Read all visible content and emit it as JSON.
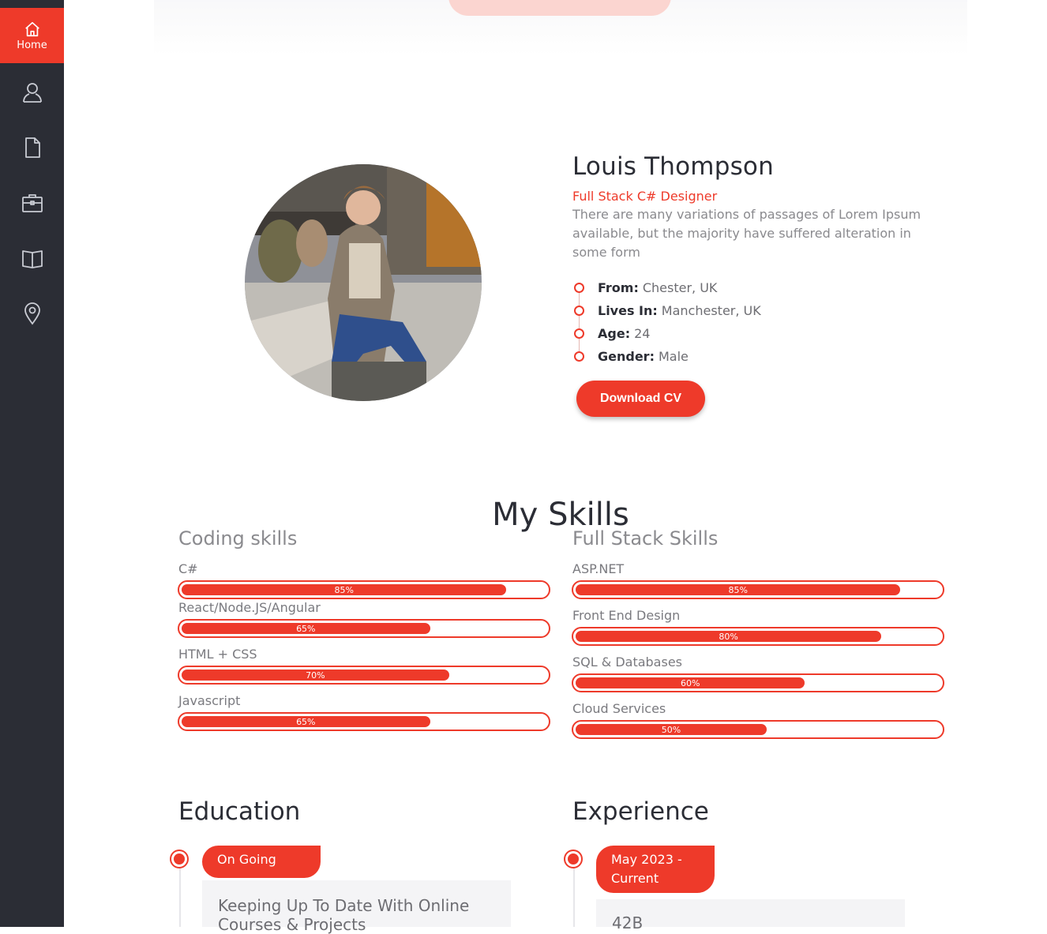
{
  "sidebar": {
    "items": [
      {
        "label": "Home",
        "icon": "home-icon"
      },
      {
        "label": "",
        "icon": "user-icon"
      },
      {
        "label": "",
        "icon": "document-icon"
      },
      {
        "label": "",
        "icon": "briefcase-icon"
      },
      {
        "label": "",
        "icon": "book-icon"
      },
      {
        "label": "",
        "icon": "map-pin-icon"
      }
    ]
  },
  "colors": {
    "accent": "#ee3a2a",
    "sidebar": "#2b2d35",
    "text": "#2b2d35",
    "muted": "#8a8a8e"
  },
  "profile": {
    "name": "Louis Thompson",
    "role": "Full Stack C# Designer",
    "description": "There are many variations of passages of Lorem Ipsum available, but the majority have suffered alteration in some form",
    "facts": [
      {
        "key": "From:",
        "value": "Chester, UK"
      },
      {
        "key": "Lives In:",
        "value": "Manchester, UK"
      },
      {
        "key": "Age:",
        "value": "24"
      },
      {
        "key": "Gender:",
        "value": "Male"
      }
    ],
    "cv_button": "Download CV"
  },
  "skills": {
    "title": "My Skills",
    "coding": {
      "title": "Coding skills",
      "items": [
        {
          "name": "C#",
          "percent": 85,
          "label": "85%"
        },
        {
          "name": "React/Node.JS/Angular",
          "percent": 65,
          "label": "65%"
        },
        {
          "name": "HTML + CSS",
          "percent": 70,
          "label": "70%"
        },
        {
          "name": "Javascript",
          "percent": 65,
          "label": "65%"
        }
      ]
    },
    "fullstack": {
      "title": "Full Stack Skills",
      "items": [
        {
          "name": "ASP.NET",
          "percent": 85,
          "label": "85%"
        },
        {
          "name": "Front End Design",
          "percent": 80,
          "label": "80%"
        },
        {
          "name": "SQL & Databases",
          "percent": 60,
          "label": "60%"
        },
        {
          "name": "Cloud Services",
          "percent": 50,
          "label": "50%"
        }
      ]
    }
  },
  "education": {
    "title": "Education",
    "badge": "On Going",
    "card_title": "Keeping Up To Date With Online Courses & Projects"
  },
  "experience": {
    "title": "Experience",
    "badge": "May 2023 - Current",
    "card_title": "42B"
  }
}
